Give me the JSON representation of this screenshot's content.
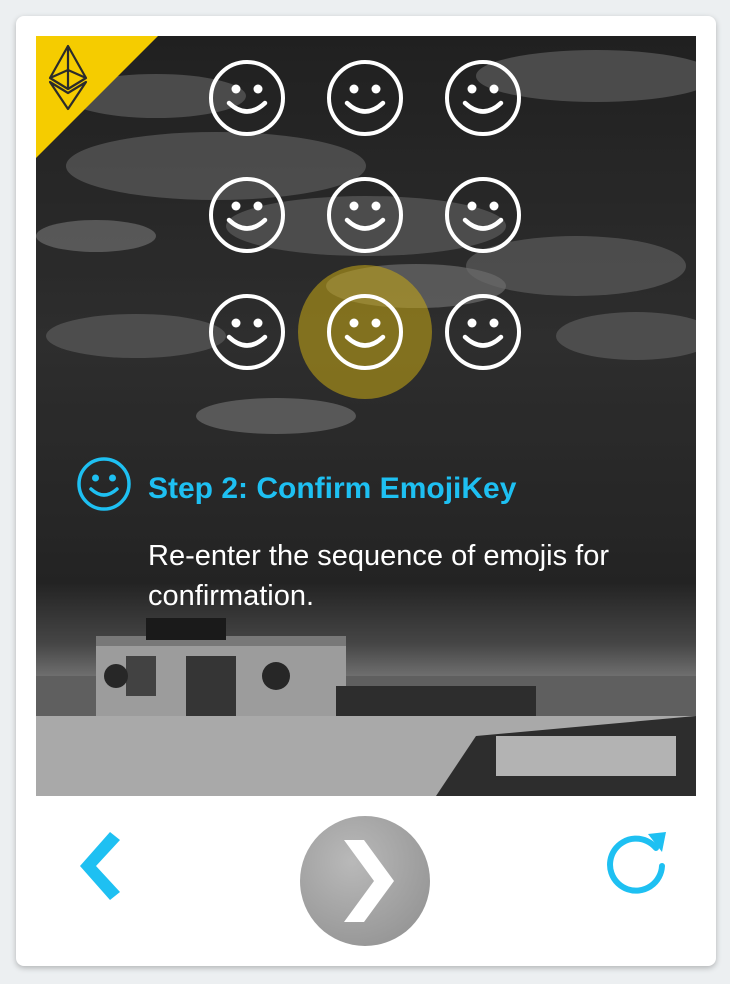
{
  "step": {
    "title": "Step 2: Confirm EmojiKey",
    "description": "Re-enter the sequence of emojis for confirmation."
  },
  "emoji_grid": {
    "rows": 3,
    "cols": 3,
    "highlighted_index": 7,
    "icon": "smiley-face-icon"
  },
  "badge": {
    "icon": "ethereum-diamond-icon",
    "color": "#f5cc00"
  },
  "colors": {
    "accent": "#1ec0f2",
    "highlight": "#c8aa14",
    "next_button": "#9e9e9e",
    "badge": "#f5cc00"
  },
  "navigation": {
    "back_icon": "chevron-left-icon",
    "next_icon": "chevron-right-icon",
    "refresh_icon": "refresh-icon"
  }
}
